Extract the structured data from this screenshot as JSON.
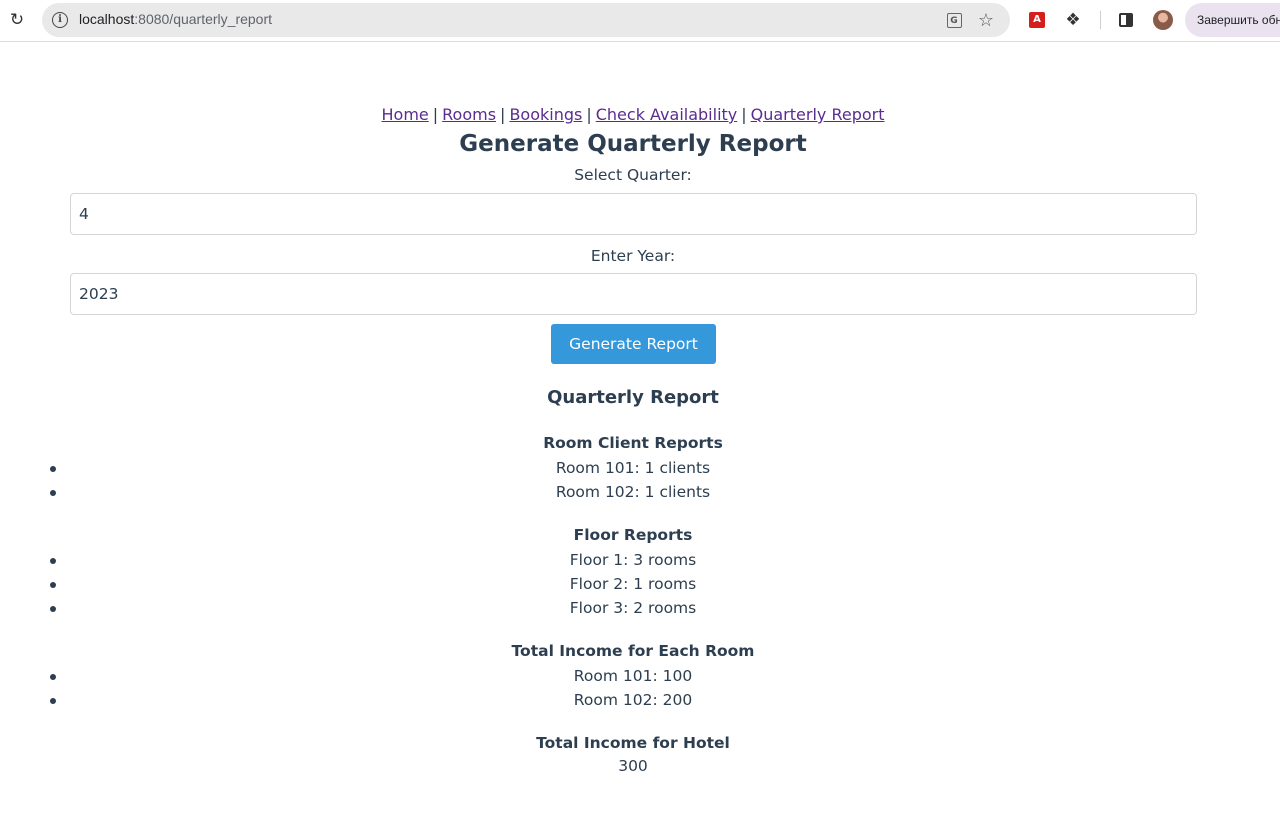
{
  "browser": {
    "url_host": "localhost",
    "url_path": ":8080/quarterly_report",
    "update_button_label": "Завершить обн"
  },
  "nav": {
    "links": [
      "Home",
      "Rooms",
      "Bookings",
      "Check Availability",
      "Quarterly Report"
    ],
    "separator": "|"
  },
  "page": {
    "title": "Generate Quarterly Report",
    "quarter_label": "Select Quarter:",
    "quarter_value": "4",
    "year_label": "Enter Year:",
    "year_value": "2023",
    "generate_button": "Generate Report"
  },
  "report": {
    "title": "Quarterly Report",
    "room_client_title": "Room Client Reports",
    "room_clients": [
      "Room 101: 1 clients",
      "Room 102: 1 clients"
    ],
    "floor_title": "Floor Reports",
    "floors": [
      "Floor 1: 3 rooms",
      "Floor 2: 1 rooms",
      "Floor 3: 2 rooms"
    ],
    "room_income_title": "Total Income for Each Room",
    "room_incomes": [
      "Room 101: 100",
      "Room 102: 200"
    ],
    "hotel_income_title": "Total Income for Hotel",
    "hotel_income_value": "300"
  }
}
